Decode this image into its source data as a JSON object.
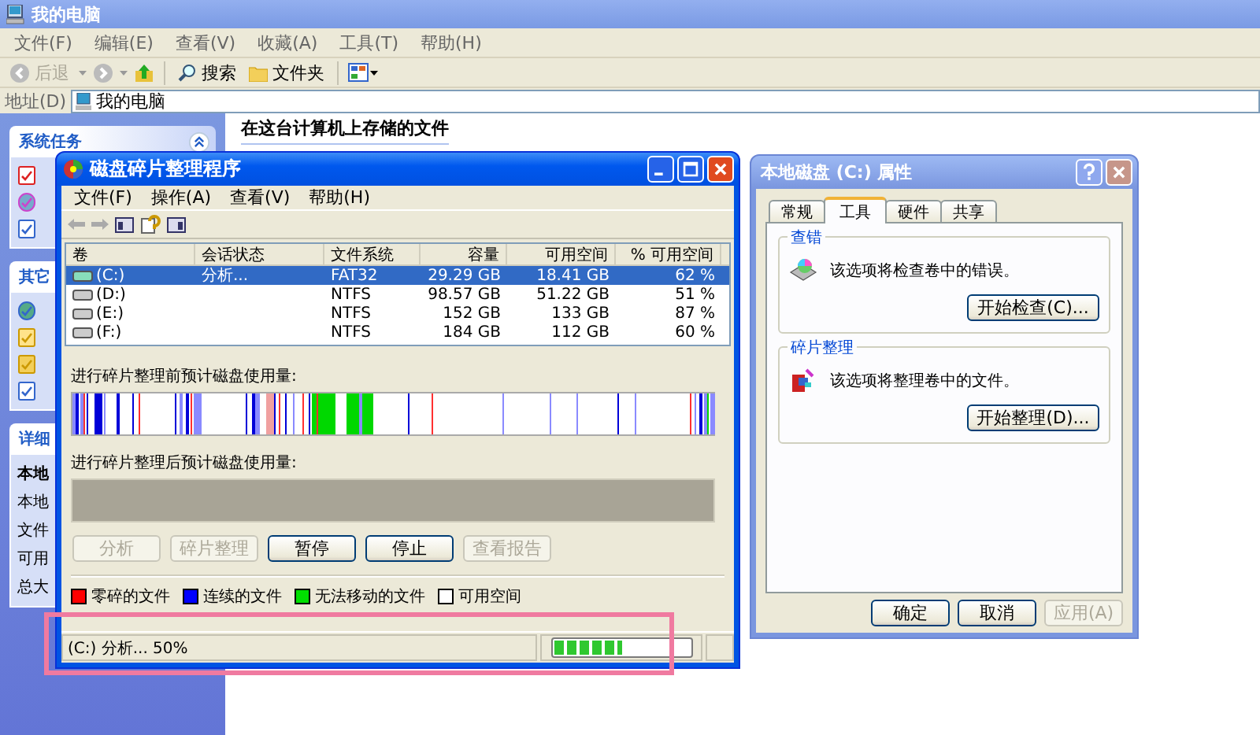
{
  "explorer": {
    "title": "我的电脑",
    "menu": [
      "文件(F)",
      "编辑(E)",
      "查看(V)",
      "收藏(A)",
      "工具(T)",
      "帮助(H)"
    ],
    "toolbar": {
      "back": "后退",
      "search": "搜索",
      "folders": "文件夹"
    },
    "address": {
      "label": "地址(D)",
      "value": "我的电脑"
    },
    "content_heading": "在这台计算机上存储的文件",
    "sidebar": [
      {
        "title": "系统任务",
        "expanded": true
      },
      {
        "title": "其它"
      },
      {
        "title": "详细",
        "lines": [
          "本地",
          "本地",
          "文件",
          "可用",
          "总大"
        ]
      }
    ]
  },
  "defrag": {
    "title": "磁盘碎片整理程序",
    "menu": [
      "文件(F)",
      "操作(A)",
      "查看(V)",
      "帮助(H)"
    ],
    "columns": [
      "卷",
      "会话状态",
      "文件系统",
      "容量",
      "可用空间",
      "% 可用空间"
    ],
    "rows": [
      {
        "cells": [
          "(C:)",
          "分析...",
          "FAT32",
          "29.29 GB",
          "18.41 GB",
          "62 %"
        ],
        "selected": true
      },
      {
        "cells": [
          "(D:)",
          "",
          "NTFS",
          "98.57 GB",
          "51.22 GB",
          "51 %"
        ],
        "selected": false
      },
      {
        "cells": [
          "(E:)",
          "",
          "NTFS",
          "152 GB",
          "133 GB",
          "87 %"
        ],
        "selected": false
      },
      {
        "cells": [
          "(F:)",
          "",
          "NTFS",
          "184 GB",
          "112 GB",
          "60 %"
        ],
        "selected": false
      }
    ],
    "before_label": "进行碎片整理前预计磁盘使用量:",
    "after_label": "进行碎片整理后预计磁盘使用量:",
    "buttons": [
      {
        "label": "分析",
        "disabled": true
      },
      {
        "label": "碎片整理",
        "disabled": true
      },
      {
        "label": "暂停",
        "disabled": false
      },
      {
        "label": "停止",
        "disabled": false
      },
      {
        "label": "查看报告",
        "disabled": true
      }
    ],
    "legend": [
      {
        "label": "零碎的文件",
        "color": "#ff0000"
      },
      {
        "label": "连续的文件",
        "color": "#0000ff"
      },
      {
        "label": "无法移动的文件",
        "color": "#00e000"
      },
      {
        "label": "可用空间",
        "color": "#ffffff"
      }
    ],
    "status": {
      "text": "(C:) 分析...  50%",
      "level": 0.5
    }
  },
  "properties": {
    "title": "本地磁盘 (C:) 属性",
    "tabs": [
      {
        "label": "常规",
        "selected": false
      },
      {
        "label": "工具",
        "selected": true
      },
      {
        "label": "硬件",
        "selected": false
      },
      {
        "label": "共享",
        "selected": false
      }
    ],
    "groups": [
      {
        "title": "查错",
        "text": "该选项将检查卷中的错误。",
        "button": "开始检查(C)..."
      },
      {
        "title": "碎片整理",
        "text": "该选项将整理卷中的文件。",
        "button": "开始整理(D)..."
      }
    ],
    "buttons": [
      {
        "label": "确定",
        "disabled": false
      },
      {
        "label": "取消",
        "disabled": false
      },
      {
        "label": "应用(A)",
        "disabled": true
      }
    ]
  },
  "annotations": [
    {
      "kind": "rectangle"
    }
  ]
}
